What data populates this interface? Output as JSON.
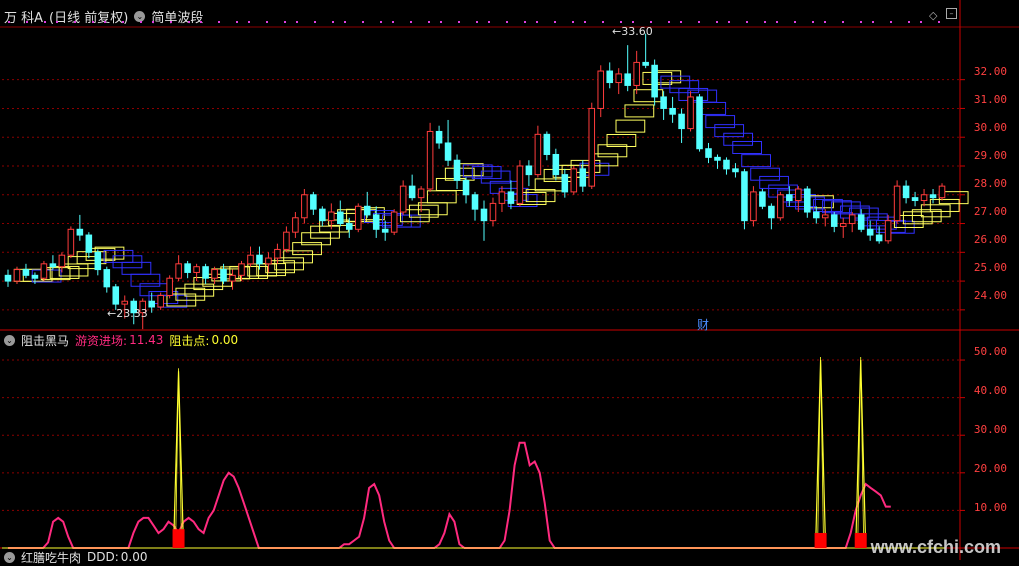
{
  "main_panel": {
    "title": "万 科A",
    "period": "(日线 前复权)",
    "indicator": "简单波段",
    "high_label": "33.60",
    "low_label": "23.33",
    "finance_marker": "财",
    "y_ticks": [
      "32.00",
      "31.00",
      "30.00",
      "29.00",
      "28.00",
      "27.00",
      "26.00",
      "25.00",
      "24.00"
    ]
  },
  "sub_panel": {
    "title": "阻击黑马",
    "field1_label": "游资进场:",
    "field1_value": "11.43",
    "field2_label": "阻击点:",
    "field2_value": "0.00",
    "y_ticks": [
      "50.00",
      "40.00",
      "30.00",
      "20.00",
      "10.00"
    ]
  },
  "bottom_panel": {
    "title": "红膳吃牛肉",
    "field_label": "DDD:",
    "field_value": "0.00"
  },
  "watermark": "www.cfchi.com",
  "colors": {
    "up": "#ff3c3c",
    "down": "#54ffff",
    "band_up": "#ffff60",
    "band_down": "#3030ff",
    "pink": "#ff2a7f",
    "spike": "#ffff30",
    "grid": "#8b0000"
  },
  "chart_data": {
    "type": "candlestick",
    "candles": [
      [
        25.2,
        25.4,
        24.8,
        25.0
      ],
      [
        25.0,
        25.5,
        24.9,
        25.4
      ],
      [
        25.4,
        25.6,
        25.1,
        25.2
      ],
      [
        25.2,
        25.3,
        24.9,
        25.1
      ],
      [
        25.1,
        25.7,
        25.0,
        25.6
      ],
      [
        25.6,
        25.9,
        25.4,
        25.5
      ],
      [
        25.5,
        26.0,
        25.3,
        25.9
      ],
      [
        25.9,
        26.9,
        25.8,
        26.8
      ],
      [
        26.8,
        27.3,
        26.4,
        26.6
      ],
      [
        26.6,
        26.7,
        25.8,
        26.0
      ],
      [
        26.0,
        26.1,
        25.2,
        25.4
      ],
      [
        25.4,
        25.5,
        24.6,
        24.8
      ],
      [
        24.8,
        24.9,
        24.0,
        24.2
      ],
      [
        24.2,
        24.5,
        23.7,
        24.3
      ],
      [
        24.3,
        24.4,
        23.5,
        23.9
      ],
      [
        23.9,
        24.4,
        23.33,
        24.3
      ],
      [
        24.3,
        24.6,
        23.9,
        24.1
      ],
      [
        24.1,
        24.6,
        24.0,
        24.5
      ],
      [
        24.5,
        25.2,
        24.4,
        25.1
      ],
      [
        25.1,
        25.9,
        25.0,
        25.6
      ],
      [
        25.6,
        25.7,
        25.1,
        25.3
      ],
      [
        25.3,
        25.6,
        25.0,
        25.5
      ],
      [
        25.5,
        25.6,
        24.9,
        25.1
      ],
      [
        25.1,
        25.5,
        24.9,
        25.4
      ],
      [
        25.4,
        25.6,
        24.9,
        25.0
      ],
      [
        25.0,
        25.4,
        24.7,
        25.2
      ],
      [
        25.2,
        25.7,
        25.0,
        25.6
      ],
      [
        25.6,
        26.2,
        25.5,
        25.9
      ],
      [
        25.9,
        26.2,
        25.4,
        25.6
      ],
      [
        25.6,
        26.0,
        25.3,
        25.8
      ],
      [
        25.8,
        26.3,
        25.6,
        26.1
      ],
      [
        26.1,
        26.9,
        26.0,
        26.7
      ],
      [
        26.7,
        27.4,
        26.5,
        27.2
      ],
      [
        27.2,
        28.2,
        27.0,
        28.0
      ],
      [
        28.0,
        28.1,
        27.3,
        27.5
      ],
      [
        27.5,
        27.6,
        26.9,
        27.1
      ],
      [
        27.1,
        27.7,
        26.8,
        27.4
      ],
      [
        27.4,
        27.8,
        26.9,
        27.0
      ],
      [
        27.0,
        27.2,
        26.5,
        26.8
      ],
      [
        26.8,
        27.7,
        26.7,
        27.6
      ],
      [
        27.6,
        28.1,
        27.2,
        27.3
      ],
      [
        27.3,
        27.6,
        26.5,
        26.8
      ],
      [
        26.8,
        27.1,
        26.4,
        26.7
      ],
      [
        26.7,
        27.5,
        26.6,
        27.4
      ],
      [
        27.4,
        28.5,
        27.3,
        28.3
      ],
      [
        28.3,
        28.7,
        27.8,
        27.9
      ],
      [
        27.9,
        28.3,
        27.4,
        28.2
      ],
      [
        28.2,
        30.5,
        28.1,
        30.2
      ],
      [
        30.2,
        30.4,
        29.6,
        29.8
      ],
      [
        29.8,
        30.6,
        29.0,
        29.2
      ],
      [
        29.2,
        29.4,
        28.2,
        28.5
      ],
      [
        28.5,
        28.6,
        27.7,
        28.0
      ],
      [
        28.0,
        28.1,
        27.1,
        27.5
      ],
      [
        27.5,
        27.8,
        26.4,
        27.1
      ],
      [
        27.1,
        27.9,
        26.9,
        27.7
      ],
      [
        27.7,
        28.3,
        27.4,
        28.1
      ],
      [
        28.1,
        28.5,
        27.5,
        27.7
      ],
      [
        27.7,
        29.2,
        27.6,
        29.0
      ],
      [
        29.0,
        29.2,
        28.3,
        28.7
      ],
      [
        28.7,
        30.4,
        28.6,
        30.1
      ],
      [
        30.1,
        30.2,
        29.2,
        29.4
      ],
      [
        29.4,
        29.6,
        28.5,
        28.7
      ],
      [
        28.7,
        28.9,
        27.9,
        28.1
      ],
      [
        28.1,
        29.0,
        28.0,
        28.9
      ],
      [
        28.9,
        29.2,
        28.1,
        28.3
      ],
      [
        28.3,
        31.2,
        28.2,
        31.0
      ],
      [
        31.0,
        32.5,
        30.7,
        32.3
      ],
      [
        32.3,
        32.6,
        31.7,
        31.9
      ],
      [
        31.9,
        32.4,
        31.5,
        32.2
      ],
      [
        32.2,
        33.2,
        31.6,
        31.8
      ],
      [
        31.8,
        33.0,
        31.5,
        32.6
      ],
      [
        32.6,
        33.6,
        32.4,
        32.5
      ],
      [
        32.5,
        32.7,
        31.1,
        31.4
      ],
      [
        31.4,
        31.6,
        30.6,
        31.0
      ],
      [
        31.0,
        31.4,
        30.5,
        30.8
      ],
      [
        30.8,
        31.0,
        29.8,
        30.3
      ],
      [
        30.3,
        31.6,
        30.2,
        31.4
      ],
      [
        31.4,
        31.5,
        29.5,
        29.6
      ],
      [
        29.6,
        29.8,
        29.1,
        29.3
      ],
      [
        29.3,
        29.4,
        28.9,
        29.2
      ],
      [
        29.2,
        29.3,
        28.7,
        28.9
      ],
      [
        28.9,
        29.1,
        28.6,
        28.8
      ],
      [
        28.8,
        28.9,
        26.8,
        27.1
      ],
      [
        27.1,
        28.3,
        26.9,
        28.1
      ],
      [
        28.1,
        28.2,
        27.5,
        27.6
      ],
      [
        27.6,
        27.7,
        26.8,
        27.2
      ],
      [
        27.2,
        28.1,
        27.1,
        28.0
      ],
      [
        28.0,
        28.3,
        27.6,
        27.8
      ],
      [
        27.8,
        28.3,
        27.4,
        28.2
      ],
      [
        28.2,
        28.3,
        27.2,
        27.4
      ],
      [
        27.4,
        27.6,
        27.0,
        27.2
      ],
      [
        27.2,
        27.5,
        26.9,
        27.3
      ],
      [
        27.3,
        27.4,
        26.7,
        26.9
      ],
      [
        26.9,
        27.2,
        26.5,
        27.0
      ],
      [
        27.0,
        27.4,
        26.7,
        27.3
      ],
      [
        27.3,
        27.5,
        26.7,
        26.8
      ],
      [
        26.8,
        27.1,
        26.4,
        26.6
      ],
      [
        26.6,
        26.9,
        26.3,
        26.4
      ],
      [
        26.4,
        27.3,
        26.3,
        27.1
      ],
      [
        27.1,
        28.5,
        27.0,
        28.3
      ],
      [
        28.3,
        28.5,
        27.7,
        27.9
      ],
      [
        27.9,
        28.1,
        27.6,
        27.8
      ],
      [
        27.8,
        28.2,
        27.6,
        28.0
      ],
      [
        28.0,
        28.2,
        27.7,
        27.9
      ],
      [
        27.9,
        28.4,
        27.8,
        28.3
      ]
    ],
    "high_value": 33.6,
    "low_value": 23.33,
    "ylim": [
      23.3,
      33.9
    ],
    "sub_ylim": [
      0,
      54
    ],
    "pink_line": [
      0,
      0,
      0,
      0,
      0,
      0,
      0,
      0,
      1.5,
      7,
      8,
      7,
      3,
      0,
      0,
      0,
      0,
      0,
      0,
      0,
      0,
      0,
      0,
      0,
      0,
      4,
      7,
      8,
      8,
      6,
      4,
      5,
      7,
      6,
      4,
      7,
      8,
      7,
      5,
      4,
      8,
      10,
      14,
      18,
      20,
      19,
      16,
      12,
      8,
      4,
      0,
      0,
      0,
      0,
      0,
      0,
      0,
      0,
      0,
      0,
      0,
      0,
      0,
      0,
      0,
      0,
      0,
      1,
      1,
      2,
      3,
      8,
      16,
      17,
      14,
      7,
      2,
      0,
      0,
      0,
      0,
      0,
      0,
      0,
      0,
      0,
      1,
      4,
      9,
      7,
      1,
      0,
      0,
      0,
      0,
      0,
      0,
      0,
      0,
      2,
      10,
      22,
      28,
      28,
      22,
      23,
      20,
      12,
      2,
      0,
      0,
      0,
      0,
      0,
      0,
      0,
      0,
      0,
      0,
      0,
      0,
      0,
      0,
      0,
      0,
      0,
      0,
      0,
      0,
      0,
      0,
      0,
      0,
      0,
      0,
      0,
      0,
      0,
      0,
      0,
      0,
      0,
      0,
      0,
      0,
      0,
      0,
      0,
      0,
      0,
      0,
      0,
      0,
      0,
      0,
      0,
      0,
      0,
      0,
      0,
      0,
      0,
      0,
      0,
      0,
      0,
      0,
      0,
      4,
      10,
      14,
      17,
      16,
      15,
      14,
      11,
      11
    ],
    "spikes": [
      {
        "x": 34,
        "value": 47,
        "block": 5
      },
      {
        "x": 162,
        "value": 50,
        "block": 4
      },
      {
        "x": 170,
        "value": 50,
        "block": 4
      }
    ],
    "sub_x_count": 188
  }
}
